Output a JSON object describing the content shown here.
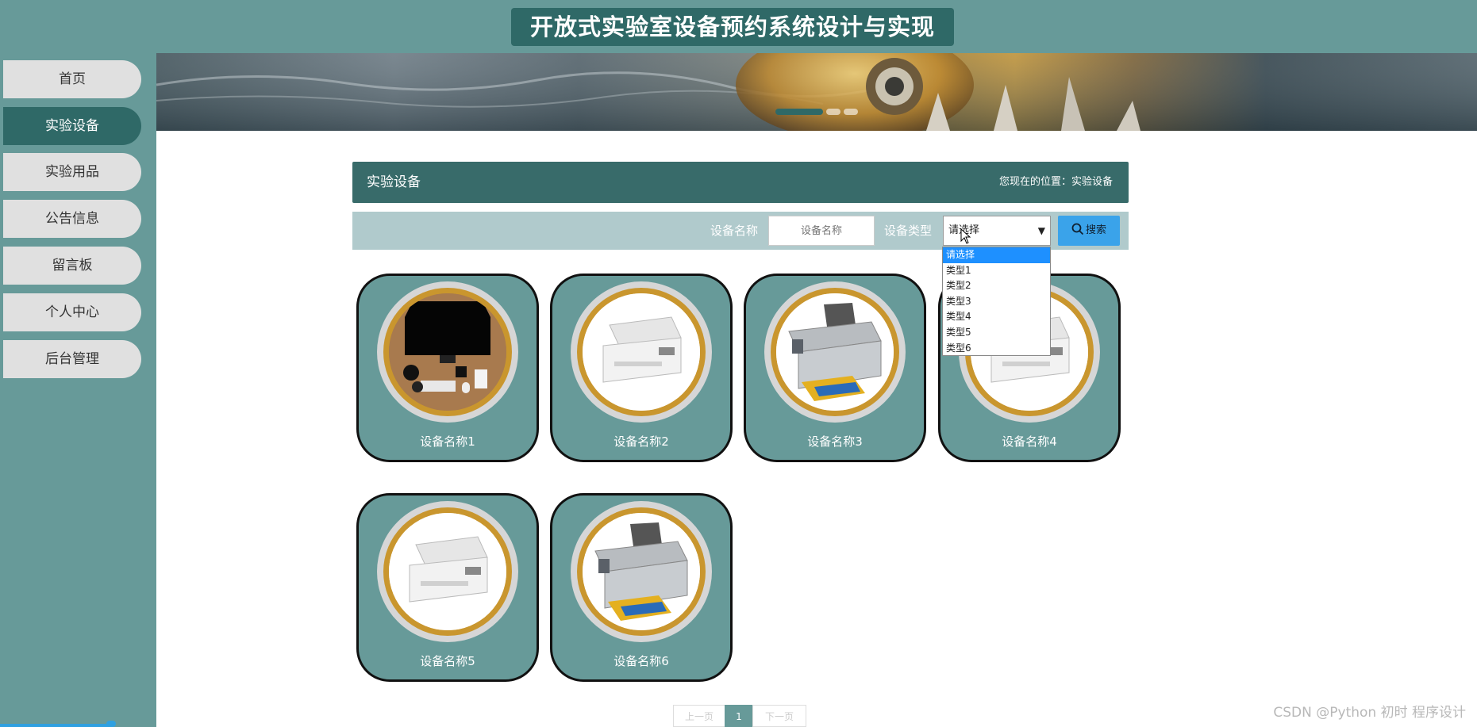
{
  "header": {
    "title": "开放式实验室设备预约系统设计与实现"
  },
  "sidebar": {
    "items": [
      {
        "label": "首页",
        "active": false
      },
      {
        "label": "实验设备",
        "active": true
      },
      {
        "label": "实验用品",
        "active": false
      },
      {
        "label": "公告信息",
        "active": false
      },
      {
        "label": "留言板",
        "active": false
      },
      {
        "label": "个人中心",
        "active": false
      },
      {
        "label": "后台管理",
        "active": false
      }
    ]
  },
  "panel": {
    "title": "实验设备",
    "breadcrumb": "您现在的位置：实验设备"
  },
  "search": {
    "name_label": "设备名称",
    "name_placeholder": "设备名称",
    "type_label": "设备类型",
    "type_selected": "请选择",
    "type_options": [
      "请选择",
      "类型1",
      "类型2",
      "类型3",
      "类型4",
      "类型5",
      "类型6"
    ],
    "button_label": "搜索"
  },
  "devices": [
    {
      "name": "设备名称1",
      "image": "desk-computer"
    },
    {
      "name": "设备名称2",
      "image": "laser-printer"
    },
    {
      "name": "设备名称3",
      "image": "inkjet-printer"
    },
    {
      "name": "设备名称4",
      "image": "laser-printer"
    },
    {
      "name": "设备名称5",
      "image": "laser-printer"
    },
    {
      "name": "设备名称6",
      "image": "inkjet-printer"
    }
  ],
  "pagination": {
    "prev": "上一页",
    "current": "1",
    "next": "下一页"
  },
  "watermark": "CSDN @Python 初时 程序设计",
  "colors": {
    "primary": "#679a99",
    "dark": "#2f6967",
    "accent": "#3aa3ea",
    "ring": "#c9962e"
  }
}
